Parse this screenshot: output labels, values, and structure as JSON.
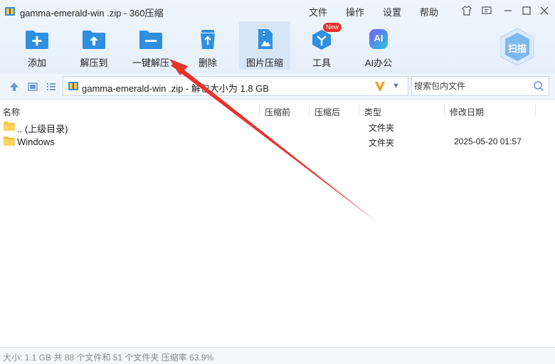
{
  "window": {
    "title": "gamma-emerald-win .zip - 360压缩",
    "menu": [
      "文件",
      "操作",
      "设置",
      "帮助"
    ]
  },
  "toolbar": {
    "add": "添加",
    "extract_to": "解压到",
    "one_click": "一键解压",
    "delete": "删除",
    "image_compress": "图片压缩",
    "tools": "工具",
    "tools_badge": "New",
    "ai_office": "AI办公",
    "ai_text": "AI",
    "scan": "扫描"
  },
  "address": {
    "path": "gamma-emerald-win .zip - 解包大小为 1.8 GB",
    "search_placeholder": "搜索包内文件"
  },
  "columns": {
    "name": "名称",
    "before": "压缩前",
    "after": "压缩后",
    "type": "类型",
    "modified": "修改日期"
  },
  "rows": [
    {
      "name": ".. (上级目录)",
      "type": "文件夹",
      "date": ""
    },
    {
      "name": "Windows",
      "type": "文件夹",
      "date": "2025-05-20 01:57"
    }
  ],
  "status": "大小: 1.1 GB 共 88 个文件和 51 个文件夹 压缩率 63.9%",
  "colors": {
    "accent": "#2f8fe0",
    "arrow": "#e8332a",
    "badge": "#e8332a",
    "active_tool": "#d7e6f7"
  }
}
